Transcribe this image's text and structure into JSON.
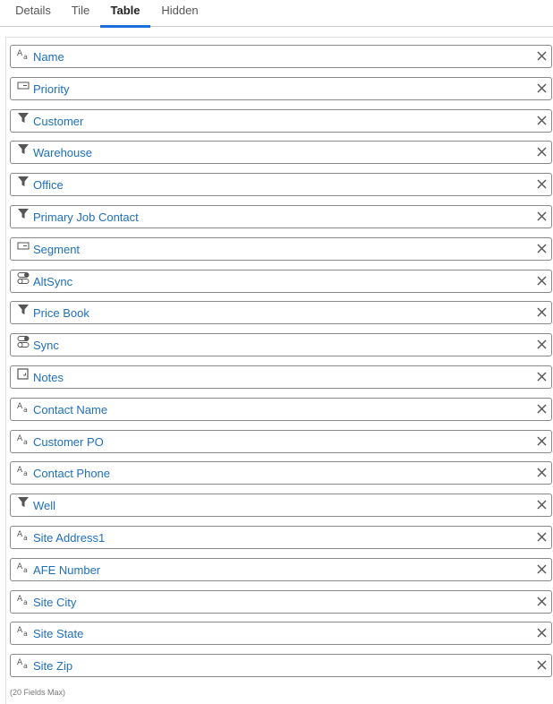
{
  "tabs": [
    {
      "label": "Details",
      "active": false
    },
    {
      "label": "Tile",
      "active": false
    },
    {
      "label": "Table",
      "active": true
    },
    {
      "label": "Hidden",
      "active": false
    }
  ],
  "fields": [
    {
      "label": "Name",
      "icon": "text-icon"
    },
    {
      "label": "Priority",
      "icon": "dropdown-icon"
    },
    {
      "label": "Customer",
      "icon": "filter-icon"
    },
    {
      "label": "Warehouse",
      "icon": "filter-icon"
    },
    {
      "label": "Office",
      "icon": "filter-icon"
    },
    {
      "label": "Primary Job Contact",
      "icon": "filter-icon"
    },
    {
      "label": "Segment",
      "icon": "dropdown-icon"
    },
    {
      "label": "AltSync",
      "icon": "toggle-icon"
    },
    {
      "label": "Price Book",
      "icon": "filter-icon"
    },
    {
      "label": "Sync",
      "icon": "toggle-icon"
    },
    {
      "label": "Notes",
      "icon": "notes-icon"
    },
    {
      "label": "Contact Name",
      "icon": "text-icon"
    },
    {
      "label": "Customer PO",
      "icon": "text-icon"
    },
    {
      "label": "Contact Phone",
      "icon": "text-icon"
    },
    {
      "label": "Well",
      "icon": "filter-icon"
    },
    {
      "label": "Site Address1",
      "icon": "text-icon"
    },
    {
      "label": "AFE Number",
      "icon": "text-icon"
    },
    {
      "label": "Site City",
      "icon": "text-icon"
    },
    {
      "label": "Site State",
      "icon": "text-icon"
    },
    {
      "label": "Site Zip",
      "icon": "text-icon"
    }
  ],
  "footer_note": "(20 Fields Max)",
  "colors": {
    "accent": "#1b6fd8",
    "label": "#1d6fbf",
    "border": "#8a8a8a"
  }
}
